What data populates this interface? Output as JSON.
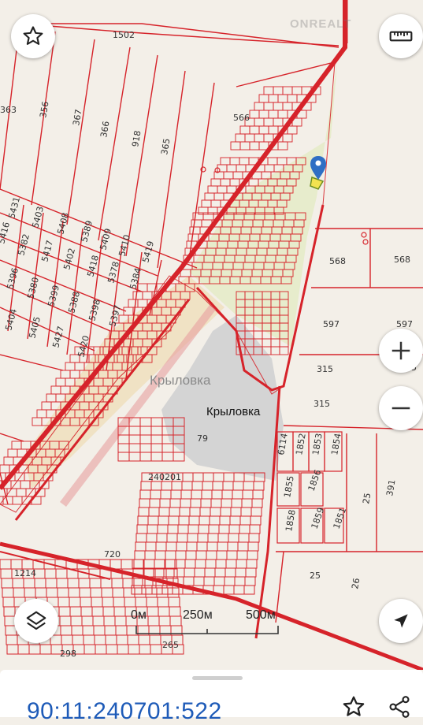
{
  "map": {
    "watermark": "ONREALT",
    "settlement_label_gray": "Крыловка",
    "settlement_label_black": "Крыловка",
    "parcels": [
      {
        "id": "p1502",
        "text": "1502"
      },
      {
        "id": "p363",
        "text": "363"
      },
      {
        "id": "p356",
        "text": "356"
      },
      {
        "id": "p367",
        "text": "367"
      },
      {
        "id": "p366",
        "text": "366"
      },
      {
        "id": "p918",
        "text": "918"
      },
      {
        "id": "p365",
        "text": "365"
      },
      {
        "id": "p566",
        "text": "566"
      },
      {
        "id": "p5431",
        "text": "5431"
      },
      {
        "id": "p5403",
        "text": "5403"
      },
      {
        "id": "p5408",
        "text": "5408"
      },
      {
        "id": "p5389",
        "text": "5389"
      },
      {
        "id": "p5409",
        "text": "5409"
      },
      {
        "id": "p5410",
        "text": "5410"
      },
      {
        "id": "p5419",
        "text": "5419"
      },
      {
        "id": "p5382",
        "text": "5382"
      },
      {
        "id": "p5417",
        "text": "5417"
      },
      {
        "id": "p5402",
        "text": "5402"
      },
      {
        "id": "p5418",
        "text": "5418"
      },
      {
        "id": "p5378",
        "text": "5378"
      },
      {
        "id": "p5384",
        "text": "5384"
      },
      {
        "id": "p5416",
        "text": "5416"
      },
      {
        "id": "p5396",
        "text": "5396"
      },
      {
        "id": "p5380",
        "text": "5380"
      },
      {
        "id": "p5399",
        "text": "5399"
      },
      {
        "id": "p5388",
        "text": "5388"
      },
      {
        "id": "p5398",
        "text": "5398"
      },
      {
        "id": "p5397",
        "text": "5397"
      },
      {
        "id": "p5404",
        "text": "5404"
      },
      {
        "id": "p5405",
        "text": "5405"
      },
      {
        "id": "p5427",
        "text": "5427"
      },
      {
        "id": "p5420",
        "text": "5420"
      },
      {
        "id": "p568a",
        "text": "568"
      },
      {
        "id": "p568b",
        "text": "568"
      },
      {
        "id": "p597a",
        "text": "597"
      },
      {
        "id": "p597b",
        "text": "597"
      },
      {
        "id": "p315a",
        "text": "315"
      },
      {
        "id": "p315b",
        "text": "315"
      },
      {
        "id": "p315c",
        "text": "315"
      },
      {
        "id": "p79",
        "text": "79"
      },
      {
        "id": "p240201",
        "text": "240201"
      },
      {
        "id": "p6114",
        "text": "6114"
      },
      {
        "id": "p1852",
        "text": "1852"
      },
      {
        "id": "p1853",
        "text": "1853"
      },
      {
        "id": "p1854",
        "text": "1854"
      },
      {
        "id": "p1855",
        "text": "1855"
      },
      {
        "id": "p1856",
        "text": "1856"
      },
      {
        "id": "p1858",
        "text": "1858"
      },
      {
        "id": "p1859",
        "text": "1859"
      },
      {
        "id": "p1851",
        "text": "1851"
      },
      {
        "id": "p25a",
        "text": "25"
      },
      {
        "id": "p391",
        "text": "391"
      },
      {
        "id": "p25b",
        "text": "25"
      },
      {
        "id": "p26",
        "text": "26"
      },
      {
        "id": "p720",
        "text": "720"
      },
      {
        "id": "p1214",
        "text": "1214"
      },
      {
        "id": "p265",
        "text": "265"
      },
      {
        "id": "p298",
        "text": "298"
      }
    ]
  },
  "scale": {
    "labels": [
      "0м",
      "250м",
      "500м"
    ]
  },
  "controls": {
    "favorite_icon": "star-outline-icon",
    "ruler_icon": "ruler-icon",
    "zoom_in_icon": "plus-icon",
    "zoom_out_icon": "minus-icon",
    "layers_icon": "layers-icon",
    "locate_icon": "navigation-arrow-icon"
  },
  "sheet": {
    "cadastral_number": "90:11:240701:522",
    "favorite_icon": "star-outline-icon",
    "share_icon": "share-icon"
  },
  "colors": {
    "boundary": "#d6232a",
    "land": "#f3efe8",
    "settlement": "#d4d4d4",
    "green": "#dfe8b6",
    "marker": "#2f6fc4",
    "link": "#1e5bb8"
  }
}
